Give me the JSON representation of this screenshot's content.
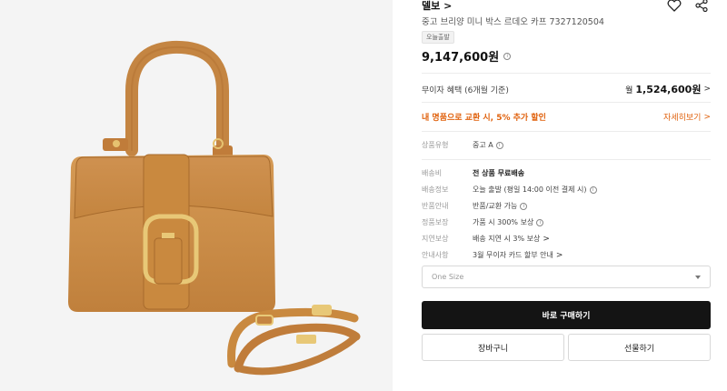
{
  "product": {
    "brand": "델보",
    "brand_chevron": ">",
    "name": "중고 브리양 미니 박스 르데오 카프 7327120504",
    "badge": "오늘출발",
    "price": "9,147,600원",
    "price_info": "i"
  },
  "installment": {
    "label": "무이자 혜택 (6개월 기준)",
    "value_prefix": "월",
    "value": "1,524,600원",
    "chevron": ">"
  },
  "promo": {
    "label": "내 명품으로 교환 시, 5% 추가 할인",
    "link": "자세히보기",
    "chevron": ">"
  },
  "condition": {
    "key": "상품유형",
    "value": "중고 A",
    "info": "i"
  },
  "details": [
    {
      "key": "배송비",
      "value": "전 상품 무료배송",
      "info": "",
      "chevron": ""
    },
    {
      "key": "배송정보",
      "value": "오늘 출발 (평일 14:00 이전 결제 시)",
      "info": "i",
      "chevron": ""
    },
    {
      "key": "반품안내",
      "value": "반품/교환 가능",
      "info": "i",
      "chevron": ""
    },
    {
      "key": "정품보장",
      "value": "가품 시 300% 보상",
      "info": "i",
      "chevron": ""
    },
    {
      "key": "지연보상",
      "value": "배송 지연 시 3% 보상",
      "info": "",
      "chevron": ">"
    },
    {
      "key": "안내사항",
      "value": "3월 무이자 카드 할부 안내",
      "info": "",
      "chevron": ">"
    }
  ],
  "size_select": {
    "value": "One Size"
  },
  "buttons": {
    "buy": "바로 구매하기",
    "cart": "장바구니",
    "gift": "선물하기"
  },
  "icons": {
    "wishlist": "heart-icon",
    "share": "share-icon"
  }
}
